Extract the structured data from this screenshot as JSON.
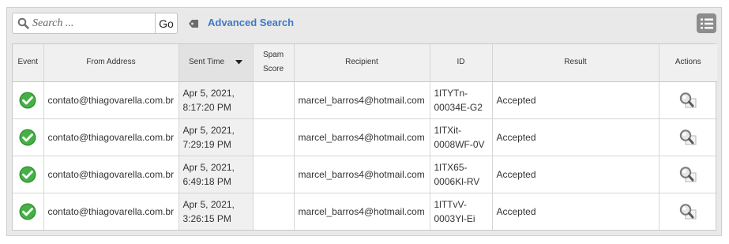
{
  "search": {
    "placeholder": "Search ...",
    "go_label": "Go"
  },
  "advanced_search_label": "Advanced Search",
  "table": {
    "headers": {
      "event": "Event",
      "from": "From Address",
      "sent": "Sent Time",
      "spam_line1": "Spam",
      "spam_line2": "Score",
      "recipient": "Recipient",
      "id": "ID",
      "result": "Result",
      "actions": "Actions"
    },
    "rows": [
      {
        "from": "contato@thiagovarella.com.br",
        "sent_date": "Apr 5, 2021,",
        "sent_time": "8:17:20 PM",
        "spam": "",
        "recipient": "marcel_barros4@hotmail.com",
        "id_line1": "1lTYTn-",
        "id_line2": "00034E-G2",
        "result": "Accepted"
      },
      {
        "from": "contato@thiagovarella.com.br",
        "sent_date": "Apr 5, 2021,",
        "sent_time": "7:29:19 PM",
        "spam": "",
        "recipient": "marcel_barros4@hotmail.com",
        "id_line1": "1lTXit-",
        "id_line2": "0008WF-0V",
        "result": "Accepted"
      },
      {
        "from": "contato@thiagovarella.com.br",
        "sent_date": "Apr 5, 2021,",
        "sent_time": "6:49:18 PM",
        "spam": "",
        "recipient": "marcel_barros4@hotmail.com",
        "id_line1": "1lTX65-",
        "id_line2": "0006Kl-RV",
        "result": "Accepted"
      },
      {
        "from": "contato@thiagovarella.com.br",
        "sent_date": "Apr 5, 2021,",
        "sent_time": "3:26:15 PM",
        "spam": "",
        "recipient": "marcel_barros4@hotmail.com",
        "id_line1": "1lTTvV-",
        "id_line2": "0003Yl-Ei",
        "result": "Accepted"
      }
    ]
  },
  "icons": {
    "search": "search-icon",
    "advanced_search": "tag-icon",
    "menu": "list-menu-icon",
    "event": "check-circle-icon",
    "action": "magnifier-view-icon"
  },
  "colors": {
    "link": "#3e79c8",
    "success": "#3aa63a",
    "toolbar_bg": "#e9e9e9",
    "header_bg": "#f0f0f0"
  }
}
